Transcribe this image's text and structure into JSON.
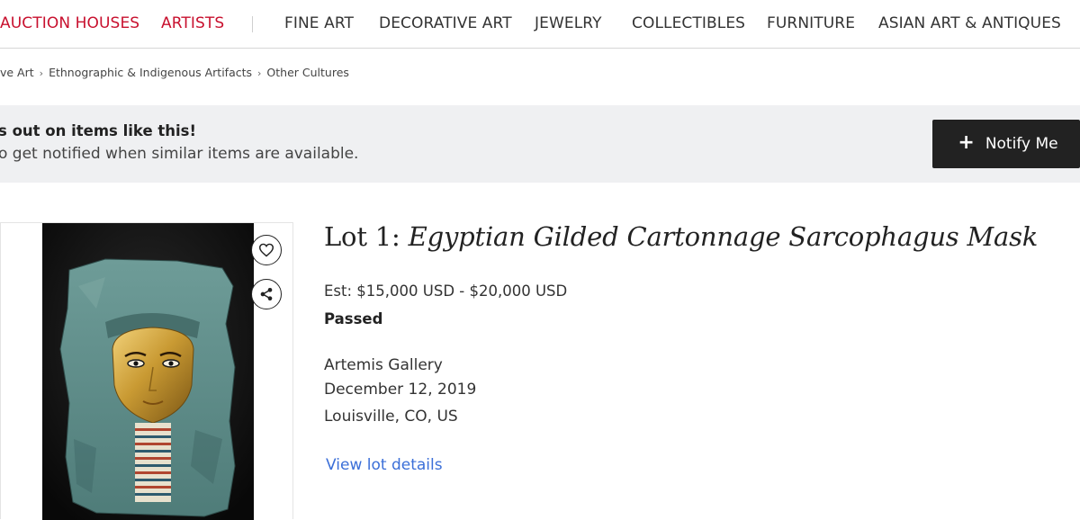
{
  "nav": {
    "primary": [
      {
        "label": "AUCTION HOUSES"
      },
      {
        "label": "ARTISTS"
      }
    ],
    "categories": [
      {
        "label": "FINE ART"
      },
      {
        "label": "DECORATIVE ART"
      },
      {
        "label": "JEWELRY"
      },
      {
        "label": "COLLECTIBLES"
      },
      {
        "label": "FURNITURE"
      },
      {
        "label": "ASIAN ART & ANTIQUES"
      }
    ],
    "accent_color": "#c8102e"
  },
  "breadcrumb": {
    "items": [
      "ve Art",
      "Ethnographic & Indigenous Artifacts",
      "Other Cultures"
    ],
    "separator": "›"
  },
  "banner": {
    "title": "s out on items like this!",
    "subtitle": "o get notified when similar items are available.",
    "button_icon": "plus-icon",
    "button_label": "Notify Me"
  },
  "image_panel": {
    "favorite_icon": "heart-icon",
    "share_icon": "share-icon"
  },
  "lot": {
    "prefix": "Lot 1: ",
    "title": "Egyptian Gilded Cartonnage Sarcophagus Mask",
    "estimate": "Est: $15,000 USD - $20,000 USD",
    "status": "Passed",
    "auction_house": "Artemis Gallery",
    "date": "December 12, 2019",
    "location": "Louisville, CO, US",
    "details_link": "View lot details",
    "link_color": "#3b6fd8"
  }
}
